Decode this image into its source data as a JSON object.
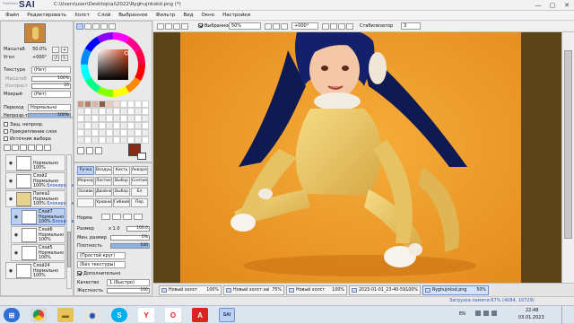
{
  "app": {
    "logo_top": "PaintTool",
    "logo_main": "SAI",
    "title": "C:\\Users\\user\\Desktop\\ai\\2022\\Ryghujnkskd.png (*)",
    "window_buttons": [
      "—",
      "▢",
      "✕"
    ]
  },
  "menu": [
    "Файл",
    "Редактировать",
    "Холст",
    "Слой",
    "Выбранное",
    "Фильтр",
    "Вид",
    "Окно",
    "Настройки"
  ],
  "navigator": {
    "zoom_label": "Масштаб",
    "zoom_value": "50.0%",
    "angle_label": "Угол",
    "angle_value": "+000°",
    "zoom_btns": [
      "-",
      "+"
    ],
    "texture_label": "Текстура",
    "texture_value": "(Нет)",
    "scale_label": "Масштаб",
    "scale_value": "100%",
    "intensity_label": "Контраст",
    "intensity_value": "20",
    "effect_label": "Мокрый",
    "effect_value": "(Нет)",
    "mode_label": "Переход",
    "mode_value": "Нормально",
    "opacity_label": "Непрозр-ть",
    "opacity_value": "100%",
    "opacity_fraction": 1.0,
    "checks": [
      {
        "label": "Защ. непрозр.",
        "on": false
      },
      {
        "label": "Прикрепление слоя",
        "on": false
      },
      {
        "label": "Источник выбора",
        "on": false
      }
    ]
  },
  "layers": [
    {
      "name": "",
      "mode": "Нормально",
      "opacity": "100%",
      "extra": "",
      "selected": false
    },
    {
      "name": "Слой2",
      "mode": "Нормально",
      "opacity": "100%",
      "extra": "Блокировка",
      "selected": false
    },
    {
      "name": "Папка2",
      "mode": "Нормально",
      "opacity": "100%",
      "extra": "Блокировка",
      "selected": false
    },
    {
      "name": "Слой7",
      "mode": "Нормально",
      "opacity": "100%",
      "extra": "Блокировка",
      "selected": true
    },
    {
      "name": "Слой6",
      "mode": "Нормально",
      "opacity": "100%",
      "extra": "",
      "selected": false
    },
    {
      "name": "Слой5",
      "mode": "Нормально",
      "opacity": "100%",
      "extra": "",
      "selected": false
    },
    {
      "name": "Слой24",
      "mode": "Нормально",
      "opacity": "100%",
      "extra": "",
      "selected": false
    }
  ],
  "colors": {
    "current": "#8b2a12",
    "background": "#ffffff",
    "palette": [
      "#c99a85",
      "#b7806e",
      "#d9b7a6",
      "#8e5a49",
      "#ebc9b5",
      "#f4e1d4",
      "#ffffff",
      "#ffffff",
      "#ffffff",
      "#ffffff"
    ],
    "accent_blue": "#6d8fd6",
    "selection_bg": "#bcd0f2"
  },
  "tools": {
    "tabs": [
      [
        "Ручка",
        "Воздушка",
        "Кисть",
        "Акварель"
      ],
      [
        "Маркер",
        "Ластик",
        "Выбор",
        "Снятие"
      ],
      [
        "Заливка",
        "Двойной",
        "Выбор",
        "Бл"
      ],
      [
        "",
        "Уровни",
        "Гибкий",
        "Пер"
      ]
    ],
    "selected_tab": "Ручка",
    "brush_shape": "Норма",
    "size_label": "Размер",
    "size_multiplier": "x 1.0",
    "size_value": "100.0",
    "min_size_label": "Мин. размер",
    "min_size_value": "0%",
    "density_label": "Плотность",
    "density_value": "100",
    "shape1": "(Простой круг)",
    "shape2": "(Без текстуры)",
    "advanced_label": "Дополнительно",
    "quality_label": "Качество",
    "quality_value": "1 (Быстро)",
    "hardness_label": "Жесткость",
    "hardness_value": "100"
  },
  "canvas_bar": {
    "selection_label": "Выбранное",
    "zoom_value": "50%",
    "angle_value": "+000°",
    "smooth_label": "Стабилизатор",
    "smooth_value": "3"
  },
  "doc_tabs": [
    {
      "name": "Новый холст",
      "pct": "100%",
      "selected": false
    },
    {
      "name": "Новый холст.sai",
      "pct": "75%",
      "selected": false
    },
    {
      "name": "Новый холст",
      "pct": "100%",
      "selected": false
    },
    {
      "name": "2023-01-01_23-40-59...",
      "pct": "100%",
      "selected": false
    },
    {
      "name": "Ryghujnksd.png",
      "pct": "50%",
      "selected": true
    }
  ],
  "status": {
    "memory": "Загрузка памяти:67% (4084, 10729)"
  },
  "taskbar": {
    "lang": "EN",
    "time": "22:48",
    "date": "03.01.2023",
    "icons": [
      "start",
      "chrome",
      "explorer",
      "skype",
      "yandex",
      "opera",
      "pdf",
      "sai"
    ]
  }
}
